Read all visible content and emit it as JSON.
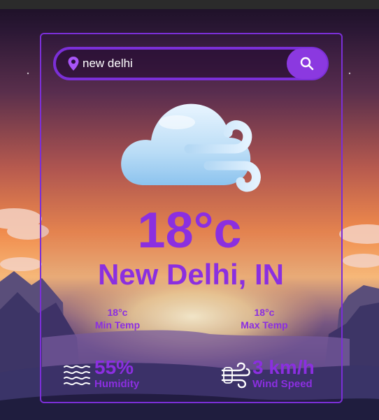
{
  "search": {
    "value": "new delhi",
    "placeholder": ""
  },
  "weather": {
    "temperature": "18°c",
    "city": "New Delhi, IN",
    "min_temp": {
      "value": "18°c",
      "label": "Min Temp"
    },
    "max_temp": {
      "value": "18°c",
      "label": "Max Temp"
    },
    "humidity": {
      "value": "55%",
      "label": "Humidity"
    },
    "wind": {
      "value": "3 km/h",
      "label": "Wind Speed"
    }
  },
  "icons": {
    "location": "map-pin-icon",
    "search": "search-icon",
    "weather": "cloud-wind-icon",
    "humidity": "humidity-waves-icon",
    "wind": "wind-icon"
  },
  "colors": {
    "accent": "#8b2fe0",
    "border": "#7b2fd7",
    "button": "#8b39e0"
  }
}
